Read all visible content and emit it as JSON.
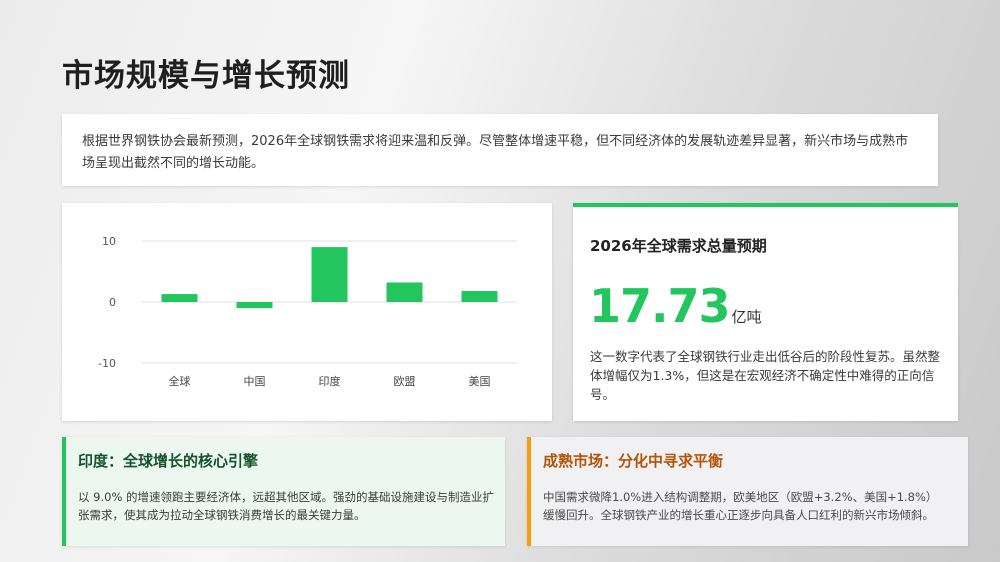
{
  "page": {
    "title": "市场规模与增长预测",
    "intro": "根据世界钢铁协会最新预测，2026年全球钢铁需求将迎来温和反弹。尽管整体增速平稳，但不同经济体的发展轨迹差异显著，新兴市场与成熟市场呈现出截然不同的增长动能。"
  },
  "stat": {
    "title": "2026年全球需求总量预期",
    "value": "17.73",
    "unit": "亿吨",
    "description": "这一数字代表了全球钢铁行业走出低谷后的阶段性复苏。虽然整体增幅仅为1.3%，但这是在宏观经济不确定性中难得的正向信号。"
  },
  "cards": {
    "india": {
      "title": "印度：全球增长的核心引擎",
      "text": "以 9.0% 的增速领跑主要经济体，远超其他区域。强劲的基础设施建设与制造业扩张需求，使其成为拉动全球钢铁消费增长的最关键力量。"
    },
    "mature": {
      "title": "成熟市场：分化中寻求平衡",
      "text": "中国需求微降1.0%进入结构调整期，欧美地区（欧盟+3.2%、美国+1.8%）缓慢回升。全球钢铁产业的增长重心正逐步向具备人口红利的新兴市场倾斜。"
    }
  },
  "colors": {
    "accent_green": "#22c55e",
    "accent_orange": "#f59e0b"
  },
  "chart_data": {
    "type": "bar",
    "categories": [
      "全球",
      "中国",
      "印度",
      "欧盟",
      "美国"
    ],
    "values": [
      1.3,
      -1.0,
      9.0,
      3.2,
      1.8
    ],
    "yticks": [
      10,
      0,
      -10
    ],
    "ylim": [
      -10,
      10
    ],
    "title": "",
    "xlabel": "",
    "ylabel": "",
    "grid": true,
    "bar_color": "#22c55e"
  }
}
